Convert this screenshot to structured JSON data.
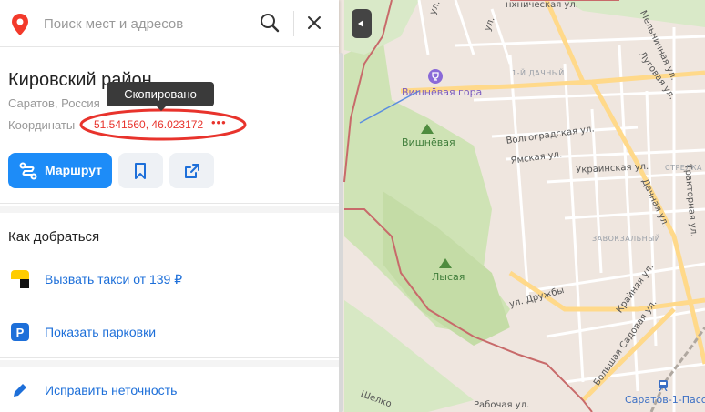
{
  "search": {
    "placeholder": "Поиск мест и адресов"
  },
  "place": {
    "title": "Кировский район",
    "subtitle": "Саратов, Россия",
    "coords_label": "Координаты",
    "coords_value": "51.541560, 46.023172",
    "more": "•••"
  },
  "tooltip": {
    "text": "Скопировано"
  },
  "actions": {
    "route_label": "Маршрут"
  },
  "how_to_get": {
    "title": "Как добраться",
    "taxi_label": "Вызвать такси от 139 ₽",
    "parking_label": "Показать парковки"
  },
  "feedback": {
    "label": "Исправить неточность"
  },
  "map": {
    "streets": [
      "ул.",
      "ул.",
      "нхническая ул.",
      "Мельничная ул.",
      "Луговая ул.",
      "Волгоградская ул.",
      "Ямская ул.",
      "Украинская ул.",
      "Дачная ул.",
      "Тракторная ул.",
      "ул. Дружбы",
      "Крайняя ул.",
      "Большая Садовая ул.",
      "Рабочая ул.",
      "Шелко"
    ],
    "districts": [
      "1-Й ДАЧНЫЙ",
      "СТРЕЛКА",
      "ЗАВОКЗАЛЬНЫЙ"
    ],
    "pois": {
      "vishnevaya_gora": "Вишнёвая гора",
      "vishnevaya": "Вишнёвая",
      "lysaya": "Лысая",
      "station": "Саратов-1-Пасс"
    }
  },
  "colors": {
    "accent": "#1d8cf8",
    "link": "#1d6fd9",
    "highlight": "#e8332c",
    "park": "#cfe3b5",
    "road": "#ffd98a",
    "boundary": "#c86a6a"
  }
}
